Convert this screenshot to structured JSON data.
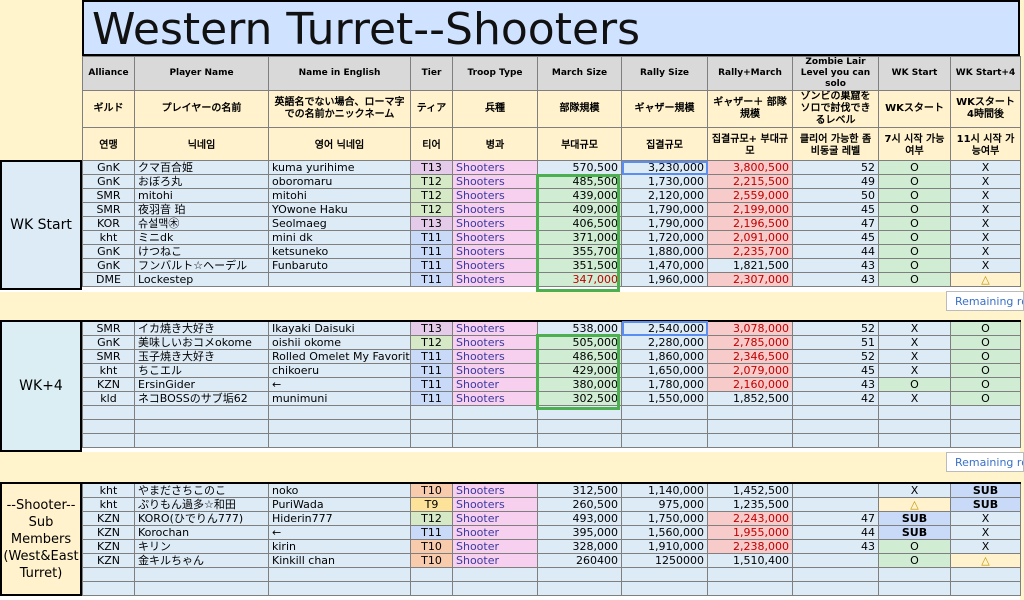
{
  "title": "Western Turret--Shooters",
  "headers": {
    "en": [
      "Alliance",
      "Player Name",
      "Name in English",
      "Tier",
      "Troop Type",
      "March Size",
      "Rally Size",
      "Rally+March",
      "Zombie Lair Level you can solo",
      "WK Start",
      "WK Start+4"
    ],
    "jp": [
      "ギルド",
      "プレイヤーの名前",
      "英語名でない場合、ローマ字での名前かニックネーム",
      "ティア",
      "兵種",
      "部隊規模",
      "ギャザー規模",
      "ギャザー＋ 部隊規模",
      "ゾンビの巣窟をソロで討伐できるレベル",
      "WKスタート",
      "WKスタート4時間後"
    ],
    "kr": [
      "연맹",
      "닉네임",
      "영어 닉네임",
      "티어",
      "병과",
      "부대규모",
      "집결규모",
      "집결규모+ 부대규모",
      "클리어 가능한 좀비동굴 레벨",
      "7시 시작 가능여부",
      "11시 시작 가능여부"
    ]
  },
  "groups": {
    "wk_start": "WK Start",
    "wk4": "WK+4",
    "sub": "--Shooter--Sub Members (West&East Turret)"
  },
  "remaining_label": "Remaining ro",
  "wk_start_rows": [
    {
      "a": "GnK",
      "p": "クマ百合姫",
      "e": "kuma yurihime",
      "t": "T13",
      "tt": "Shooters",
      "m": "570,500",
      "r": "3,230,000",
      "rm": "3,800,500",
      "z": "52",
      "s": "O",
      "s4": "X"
    },
    {
      "a": "GnK",
      "p": "おぼろ丸",
      "e": "oboromaru",
      "t": "T12",
      "tt": "Shooters",
      "m": "485,500",
      "r": "1,730,000",
      "rm": "2,215,500",
      "z": "49",
      "s": "O",
      "s4": "X"
    },
    {
      "a": "SMR",
      "p": "mitohi",
      "e": "mitohi",
      "t": "T12",
      "tt": "Shooters",
      "m": "439,000",
      "r": "2,120,000",
      "rm": "2,559,000",
      "z": "50",
      "s": "O",
      "s4": "X"
    },
    {
      "a": "SMR",
      "p": "夜羽音 珀",
      "e": "YOwone Haku",
      "t": "T12",
      "tt": "Shooters",
      "m": "409,000",
      "r": "1,790,000",
      "rm": "2,199,000",
      "z": "45",
      "s": "O",
      "s4": "X"
    },
    {
      "a": "KOR",
      "p": "슈설맥㊍",
      "e": "Seolmaeg",
      "t": "T13",
      "tt": "Shooters",
      "m": "406,500",
      "r": "1,790,000",
      "rm": "2,196,500",
      "z": "47",
      "s": "O",
      "s4": "X"
    },
    {
      "a": "kht",
      "p": "ミニdk",
      "e": "mini dk",
      "t": "T11",
      "tt": "Shooters",
      "m": "371,000",
      "r": "1,720,000",
      "rm": "2,091,000",
      "z": "45",
      "s": "O",
      "s4": "X"
    },
    {
      "a": "GnK",
      "p": "けつねこ",
      "e": "ketsuneko",
      "t": "T11",
      "tt": "Shooters",
      "m": "355,700",
      "r": "1,880,000",
      "rm": "2,235,700",
      "z": "44",
      "s": "O",
      "s4": "X"
    },
    {
      "a": "GnK",
      "p": "フンバルト☆ヘーデル",
      "e": "Funbaruto",
      "t": "T11",
      "tt": "Shooters",
      "m": "351,500",
      "r": "1,470,000",
      "rm": "1,821,500",
      "z": "43",
      "s": "O",
      "s4": "X"
    },
    {
      "a": "DME",
      "p": "Lockestep",
      "e": "",
      "t": "T11",
      "tt": "Shooters",
      "m": "347,000",
      "r": "1,960,000",
      "rm": "2,307,000",
      "z": "43",
      "s": "O",
      "s4": "△"
    }
  ],
  "wk4_rows": [
    {
      "a": "SMR",
      "p": "イカ焼き大好き",
      "e": "Ikayaki Daisuki",
      "t": "T13",
      "tt": "Shooters",
      "m": "538,000",
      "r": "2,540,000",
      "rm": "3,078,000",
      "z": "52",
      "s": "X",
      "s4": "O"
    },
    {
      "a": "GnK",
      "p": "美味しいおコメokome",
      "e": "oishii okome",
      "t": "T12",
      "tt": "Shooters",
      "m": "505,000",
      "r": "2,280,000",
      "rm": "2,785,000",
      "z": "51",
      "s": "X",
      "s4": "O"
    },
    {
      "a": "SMR",
      "p": "玉子焼き大好き",
      "e": "Rolled Omelet My Favorite",
      "t": "T11",
      "tt": "Shooters",
      "m": "486,500",
      "r": "1,860,000",
      "rm": "2,346,500",
      "z": "52",
      "s": "X",
      "s4": "O"
    },
    {
      "a": "kht",
      "p": "ちこエル",
      "e": "chikoeru",
      "t": "T11",
      "tt": "Shooters",
      "m": "429,000",
      "r": "1,650,000",
      "rm": "2,079,000",
      "z": "45",
      "s": "X",
      "s4": "O"
    },
    {
      "a": "KZN",
      "p": "ErsinGider",
      "e": "←",
      "t": "T11",
      "tt": "Shooter",
      "m": "380,000",
      "r": "1,780,000",
      "rm": "2,160,000",
      "z": "43",
      "s": "O",
      "s4": "O"
    },
    {
      "a": "kld",
      "p": "ネコBOSSのサブ垢62",
      "e": "munimuni",
      "t": "T11",
      "tt": "Shooters",
      "m": "302,500",
      "r": "1,550,000",
      "rm": "1,852,500",
      "z": "42",
      "s": "X",
      "s4": "O"
    }
  ],
  "sub_rows": [
    {
      "a": "kht",
      "p": "やまださちこのこ",
      "e": "noko",
      "t": "T10",
      "tt": "Shooters",
      "m": "312,500",
      "r": "1,140,000",
      "rm": "1,452,500",
      "z": "",
      "s": "X",
      "s4": "SUB"
    },
    {
      "a": "kht",
      "p": "ぷりもん過多☆和田",
      "e": "PuriWada",
      "t": "T9",
      "tt": "Shooters",
      "m": "260,500",
      "r": "975,000",
      "rm": "1,235,500",
      "z": "",
      "s": "△",
      "s4": "SUB"
    },
    {
      "a": "KZN",
      "p": "KORO(ひでりん777)",
      "e": "Hiderin777",
      "t": "T12",
      "tt": "Shooter",
      "m": "493,000",
      "r": "1,750,000",
      "rm": "2,243,000",
      "z": "47",
      "s": "SUB",
      "s4": "X"
    },
    {
      "a": "KZN",
      "p": "Korochan",
      "e": "←",
      "t": "T11",
      "tt": "Shooter",
      "m": "395,000",
      "r": "1,560,000",
      "rm": "1,955,000",
      "z": "44",
      "s": "SUB",
      "s4": "X"
    },
    {
      "a": "KZN",
      "p": "キリン",
      "e": "kirin",
      "t": "T10",
      "tt": "Shooter",
      "m": "328,000",
      "r": "1,910,000",
      "rm": "2,238,000",
      "z": "43",
      "s": "O",
      "s4": "X"
    },
    {
      "a": "KZN",
      "p": "金キルちゃん",
      "e": "Kinkill chan",
      "t": "T10",
      "tt": "Shooter",
      "m": "260400",
      "r": "1250000",
      "rm": "1,510,400",
      "z": "",
      "s": "O",
      "s4": "△"
    }
  ]
}
